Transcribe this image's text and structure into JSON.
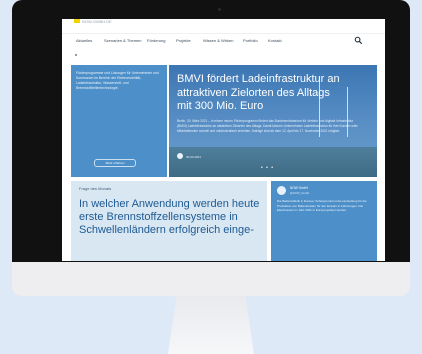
{
  "site": {
    "logo_text": "NOW-GMBH.DE"
  },
  "nav": {
    "items": [
      "Aktuelles",
      "Szenarien & Themen",
      "Förderung",
      "Projekte",
      "Wissen & Wirken",
      "Portfolio",
      "Kontakt"
    ]
  },
  "left_panel": {
    "text": "Förderprogramme und Lösungen für Unternehmen und Kommunen im Bereich der Elektromobilität, Ladeinfrastruktur, Wasserstoff- und Brennstoffzellentechnologie.",
    "button_label": "Mehr erfahren"
  },
  "hero": {
    "title": "BMVI fördert Ladeinfrastruktur an attraktiven Zielorten des Alltags mit 300 Mio. Euro",
    "body": "Berlin, 30. März 2021 – In einem neuen Förderprogramm fördert das Bundesministerium für Verkehr und digitale Infrastruktur (BMVI) Ladeinfrastruktur an attraktiven Zielorten des Alltags. Damit können Unternehmen Ladeinfrastruktur für ihre Kunden oder Mitarbeitenden schnell und unbürokratisch errichten. Anträge sind ab dem 12. April bis 17. November 2021 möglich.",
    "date": "30.03.2021",
    "pagination": "• • •"
  },
  "question": {
    "label": "Frage des Monats",
    "title": "In welcher Anwendung werden heute erste Brennstoffzellensysteme in Schwellenländern erfolgreich einge-"
  },
  "social": {
    "name": "NOW GmbH",
    "handle": "@NOW_GmbH",
    "text": "Die Batteriefabrik in Europa: Schwerpunkt ist die Herstellung für die Produktion von Batteriezellen für den Einsatz in Fahrzeugen. Die Elektroautos im Jahr 2021 in Europa gebaut werden."
  }
}
